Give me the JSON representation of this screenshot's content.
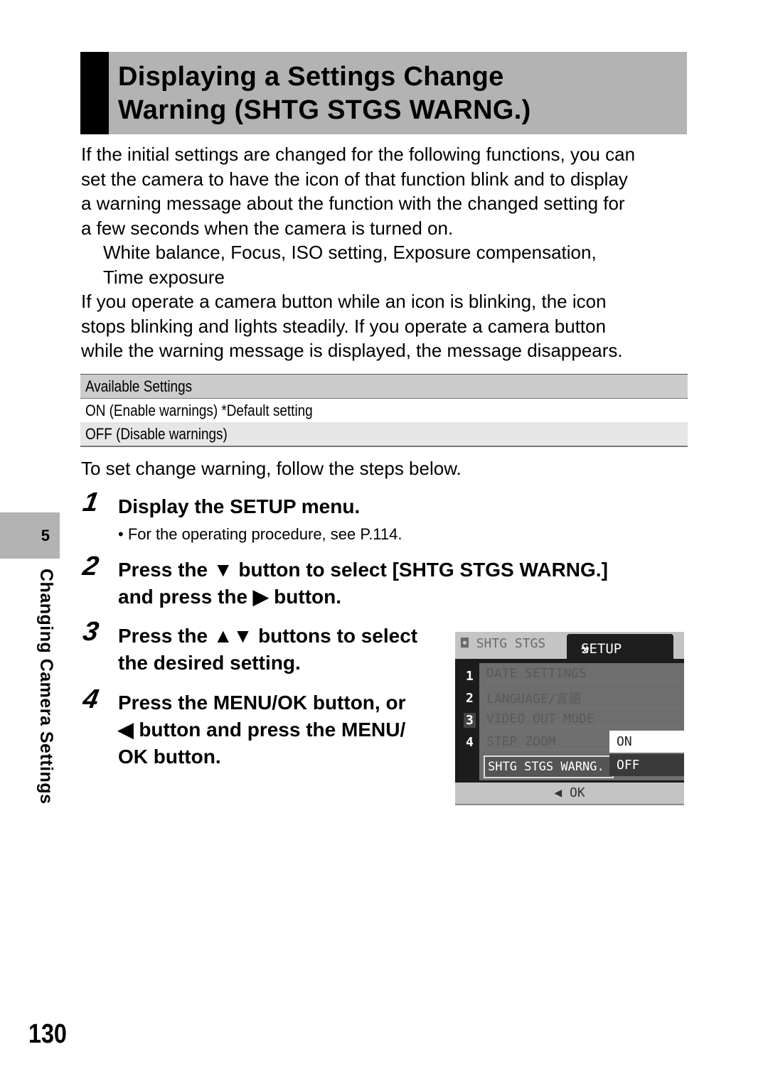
{
  "title": {
    "line1": "Displaying a Settings Change",
    "line2": "Warning (SHTG STGS WARNG.)"
  },
  "intro": {
    "lines": [
      "If the initial settings are changed for the following functions, you can",
      "set the camera to have the icon of that function blink and to display",
      "a warning message about the function with the changed setting for",
      "a few seconds when the camera is turned on."
    ],
    "functions_line1": "White balance, Focus, ISO setting, Exposure compensation,",
    "functions_line2": "Time exposure",
    "lines2": [
      "If you operate a camera button while an icon is blinking, the icon",
      "stops blinking and lights steadily. If you operate a camera button",
      "while the warning message is displayed, the message disappears."
    ]
  },
  "settings_table": {
    "header": "Available Settings",
    "rows": [
      "ON (Enable warnings) *Default setting",
      "OFF (Disable warnings)"
    ]
  },
  "steps_intro": "To set change warning, follow the steps below.",
  "steps": [
    {
      "num": "1",
      "line1": "Display the SETUP menu.",
      "bullet": "For the operating procedure, see P.114."
    },
    {
      "num": "2",
      "line1_pre": "Press the ",
      "line1_icon": "▼",
      "line1_post": " button to select [SHTG STGS WARNG.]",
      "line2_pre": "and press the ",
      "line2_icon": "▶",
      "line2_post": " button."
    },
    {
      "num": "3",
      "line1_pre": "Press the ",
      "line1_icon": "▲▼",
      "line1_post": " buttons to select",
      "line2": "the desired setting."
    },
    {
      "num": "4",
      "line1": "Press the MENU/OK button, or",
      "line2_icon": "◀",
      "line2_post": " button and press the MENU/",
      "line3": "OK button."
    }
  ],
  "camera_screen": {
    "tab_inactive": "SHTG STGS",
    "tab_active": "SETUP",
    "page_numbers": [
      "1",
      "2",
      "3",
      "4"
    ],
    "items": [
      "DATE SETTINGS",
      "LANGUAGE/言語",
      "VIDEO OUT MODE",
      "STEP ZOOM"
    ],
    "selected_item": "SHTG STGS WARNG.",
    "options": [
      "ON",
      "OFF"
    ],
    "footer": "◀ OK"
  },
  "side_tab": {
    "chapter": "5",
    "label": "Changing Camera Settings"
  },
  "page_number": "130"
}
